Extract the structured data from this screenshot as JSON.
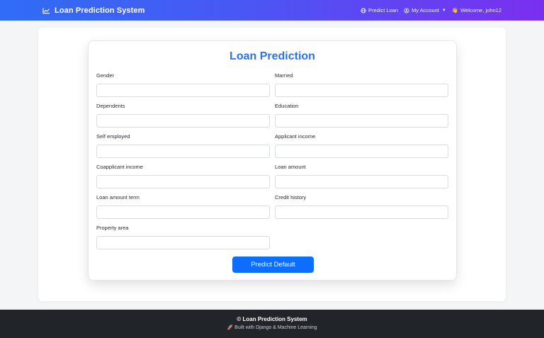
{
  "navbar": {
    "brand": "Loan Prediction System",
    "brand_icon": "chart-line-icon",
    "predict_loan": "Predict Loan",
    "my_account": "My Account",
    "welcome": "Welcome, john12",
    "colors": {
      "gradient_start": "#2f6df5",
      "gradient_end": "#7a2ff0"
    }
  },
  "form": {
    "title": "Loan Prediction",
    "fields": [
      {
        "label": "Gender",
        "value": "",
        "placeholder": ""
      },
      {
        "label": "Married",
        "value": "",
        "placeholder": ""
      },
      {
        "label": "Dependents",
        "value": "",
        "placeholder": ""
      },
      {
        "label": "Education",
        "value": "",
        "placeholder": ""
      },
      {
        "label": "Self employed",
        "value": "",
        "placeholder": ""
      },
      {
        "label": "Applicant income",
        "value": "",
        "placeholder": ""
      },
      {
        "label": "Coapplicant income",
        "value": "",
        "placeholder": ""
      },
      {
        "label": "Loan amount",
        "value": "",
        "placeholder": ""
      },
      {
        "label": "Loan amount term",
        "value": "",
        "placeholder": ""
      },
      {
        "label": "Credit history",
        "value": "",
        "placeholder": ""
      },
      {
        "label": "Property area",
        "value": "",
        "placeholder": ""
      }
    ],
    "submit_label": "Predict Default",
    "accent_color": "#0d6efd"
  },
  "footer": {
    "title": "© Loan Prediction System",
    "subtitle": "🚀 Built with Django & Machine Learning"
  }
}
